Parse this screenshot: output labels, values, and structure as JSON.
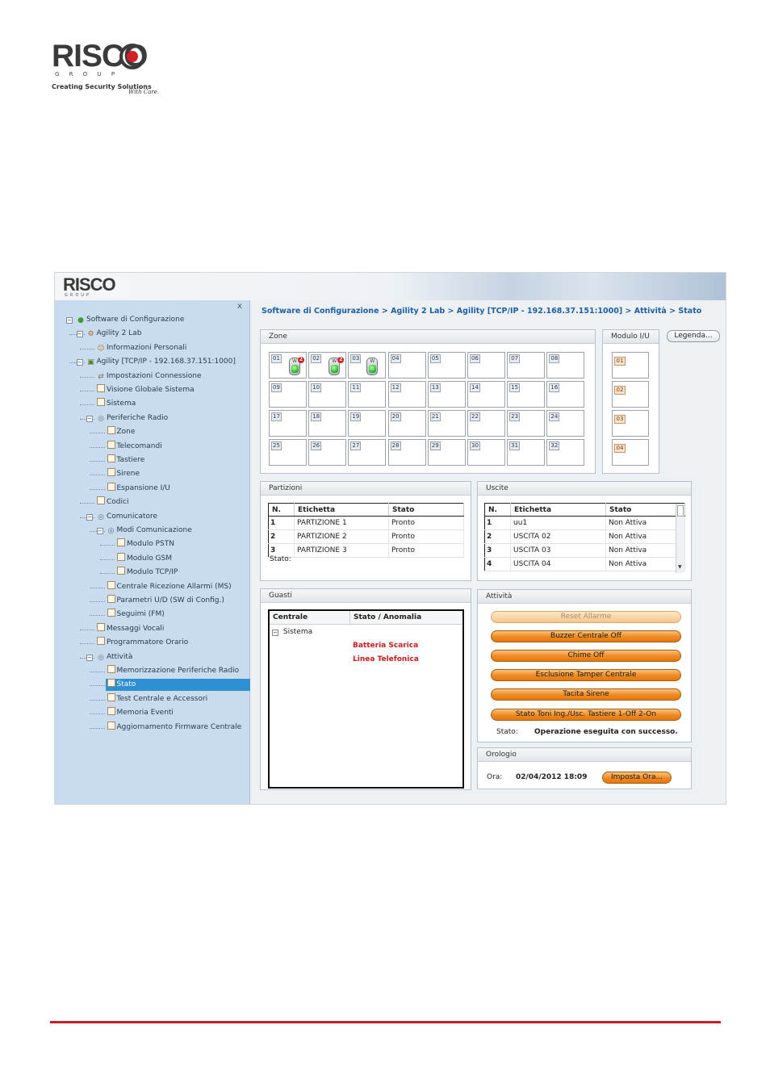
{
  "page": {
    "logo_text": "RISCO",
    "logo_sub": "G R O U P",
    "logo_tagline": "Creating Security Solutions",
    "logo_tagline_script": "With Care."
  },
  "app": {
    "header_logo": "RISCO",
    "header_logo_sub": "GROUP",
    "close_label": "x",
    "breadcrumb": "Software di Configurazione > Agility 2 Lab > Agility [TCP/IP - 192.168.37.151:1000] > Attività > Stato"
  },
  "tree": [
    {
      "label": "Software di Configurazione",
      "icon": "globe-icon"
    },
    {
      "label": "Agility 2 Lab",
      "icon": "network-icon"
    },
    {
      "label": "Informazioni Personali",
      "icon": "user-icon"
    },
    {
      "label": "Agility [TCP/IP - 192.168.37.151:1000]",
      "icon": "panel-icon"
    },
    {
      "label": "Impostazioni Connessione",
      "icon": "connection-icon"
    },
    {
      "label": "Visione Globale Sistema",
      "icon": "checkbox-icon"
    },
    {
      "label": "Sistema",
      "icon": "checkbox-icon"
    },
    {
      "label": "Periferiche Radio",
      "icon": "radio-icon"
    },
    {
      "label": "Zone",
      "icon": "checkbox-icon"
    },
    {
      "label": "Telecomandi",
      "icon": "checkbox-icon"
    },
    {
      "label": "Tastiere",
      "icon": "checkbox-icon"
    },
    {
      "label": "Sirene",
      "icon": "checkbox-icon"
    },
    {
      "label": "Espansione I/U",
      "icon": "checkbox-icon"
    },
    {
      "label": "Codici",
      "icon": "checkbox-icon"
    },
    {
      "label": "Comunicatore",
      "icon": "radio-icon"
    },
    {
      "label": "Modi Comunicazione",
      "icon": "radio-icon"
    },
    {
      "label": "Modulo PSTN",
      "icon": "checkbox-icon"
    },
    {
      "label": "Modulo GSM",
      "icon": "checkbox-icon"
    },
    {
      "label": "Modulo TCP/IP",
      "icon": "checkbox-icon"
    },
    {
      "label": "Centrale Ricezione Allarmi (MS)",
      "icon": "checkbox-icon"
    },
    {
      "label": "Parametri U/D (SW di Config.)",
      "icon": "checkbox-icon"
    },
    {
      "label": "Seguimi (FM)",
      "icon": "checkbox-icon"
    },
    {
      "label": "Messaggi Vocali",
      "icon": "checkbox-icon"
    },
    {
      "label": "Programmatore Orario",
      "icon": "checkbox-icon"
    },
    {
      "label": "Attività",
      "icon": "radio-icon"
    },
    {
      "label": "Memorizzazione Periferiche Radio",
      "icon": "checkbox-icon"
    },
    {
      "label": "Stato",
      "icon": "checkbox-icon",
      "selected": true
    },
    {
      "label": "Test Centrale e Accessori",
      "icon": "checkbox-icon"
    },
    {
      "label": "Memoria Eventi",
      "icon": "checkbox-icon"
    },
    {
      "label": "Aggiornamento Firmware Centrale",
      "icon": "checkbox-icon"
    }
  ],
  "zone": {
    "title": "Zone",
    "labels": [
      "01",
      "02",
      "03",
      "04",
      "05",
      "06",
      "07",
      "08",
      "09",
      "10",
      "11",
      "12",
      "13",
      "14",
      "15",
      "16",
      "17",
      "18",
      "19",
      "20",
      "21",
      "22",
      "23",
      "24",
      "25",
      "26",
      "27",
      "28",
      "29",
      "30",
      "31",
      "32"
    ],
    "detectors": [
      {
        "zone": "01",
        "badge": "2",
        "label": "W"
      },
      {
        "zone": "02",
        "badge": "2",
        "label": "W"
      },
      {
        "zone": "03",
        "badge": "",
        "label": "W"
      }
    ]
  },
  "modulo_io": {
    "title": "Modulo I/U",
    "labels": [
      "01",
      "02",
      "03",
      "04"
    ]
  },
  "legenda_label": "Legenda...",
  "partizioni": {
    "title": "Partizioni",
    "headers": [
      "N.",
      "Etichetta",
      "Stato"
    ],
    "rows": [
      [
        "1",
        "PARTIZIONE 1",
        "Pronto"
      ],
      [
        "2",
        "PARTIZIONE 2",
        "Pronto"
      ],
      [
        "3",
        "PARTIZIONE 3",
        "Pronto"
      ]
    ],
    "stato_label": "Stato:"
  },
  "uscite": {
    "title": "Uscite",
    "headers": [
      "N.",
      "Etichetta",
      "Stato"
    ],
    "rows": [
      [
        "1",
        "uu1",
        "Non Attiva"
      ],
      [
        "2",
        "USCITA 02",
        "Non Attiva"
      ],
      [
        "3",
        "USCITA 03",
        "Non Attiva"
      ],
      [
        "4",
        "USCITA 04",
        "Non Attiva"
      ]
    ]
  },
  "guasti": {
    "title": "Guasti",
    "headers": [
      "Centrale",
      "Stato / Anomalia"
    ],
    "group": "Sistema",
    "faults": [
      "Batteria Scarica",
      "Linea Telefonica"
    ]
  },
  "attivita": {
    "title": "Attività",
    "buttons": [
      {
        "label": "Reset Allarme",
        "disabled": true
      },
      {
        "label": "Buzzer Centrale Off"
      },
      {
        "label": "Chime Off"
      },
      {
        "label": "Esclusione Tamper Centrale"
      },
      {
        "label": "Tacita Sirene"
      },
      {
        "label": "Stato Toni Ing./Usc. Tastiere  1-Off  2-On"
      }
    ],
    "stato_label": "Stato:",
    "stato_value": "Operazione eseguita con successo."
  },
  "orologio": {
    "title": "Orologio",
    "ora_label": "Ora:",
    "ora_value": "02/04/2012 18:09",
    "button": "Imposta Ora..."
  },
  "colors": {
    "accent_blue": "#1d5fa8",
    "selection": "#2e8fd3",
    "sidebar": "#c9dcef",
    "orange": "#ef8a22",
    "fault_red": "#d11818",
    "rule_red": "#c8202a"
  }
}
